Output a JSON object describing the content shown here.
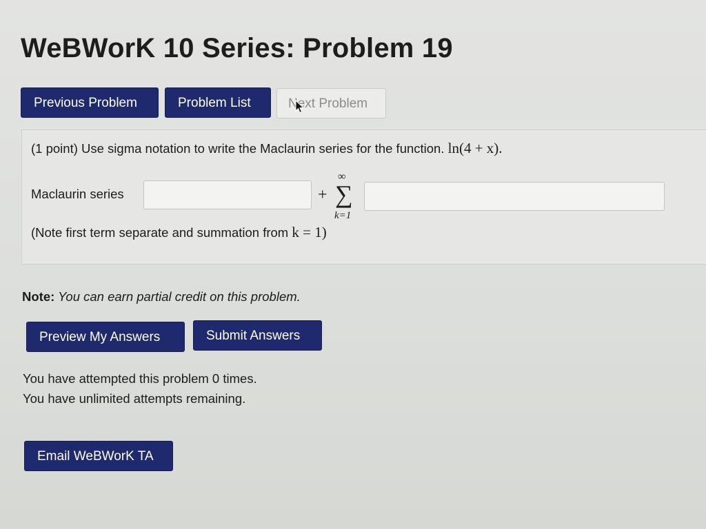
{
  "page": {
    "title": "WeBWorK 10 Series: Problem 19"
  },
  "nav": {
    "previous_label": "Previous Problem",
    "list_label": "Problem List",
    "next_label": "Next Problem"
  },
  "problem": {
    "points": "(1 point)",
    "text": " Use sigma notation to write the Maclaurin series for the function. ",
    "function": "ln(4 + x).",
    "answer_label": "Maclaurin series",
    "first_term_value": "",
    "summation_value": "",
    "plus_sign": "+",
    "sum_upper": "∞",
    "sum_symbol": "∑",
    "sum_lower": "k=1",
    "hint_text": "(Note first term separate and summation from ",
    "hint_math": "k = 1)"
  },
  "note": {
    "label": "Note:",
    "text": " You can earn partial credit on this problem."
  },
  "actions": {
    "preview_label": "Preview My Answers",
    "submit_label": "Submit Answers",
    "email_label": "Email WeBWorK TA"
  },
  "attempts": {
    "line1": "You have attempted this problem 0 times.",
    "line2": "You have unlimited attempts remaining."
  },
  "colors": {
    "primary_button": "#1f2a6e",
    "disabled_button": "#ececea",
    "panel_background": "#e6e7e4"
  },
  "icons": {
    "cursor": "mouse-pointer-icon"
  }
}
